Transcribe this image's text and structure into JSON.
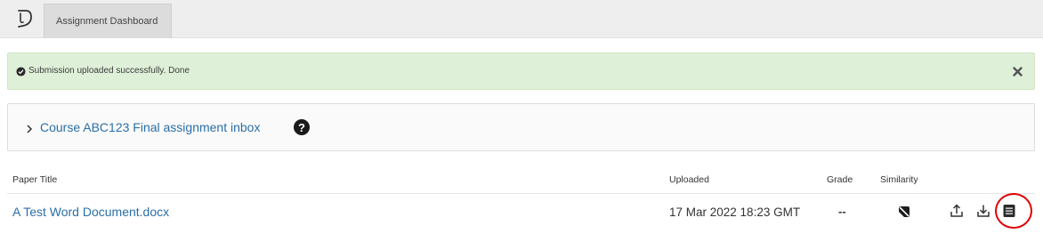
{
  "header": {
    "logo": "turnitin-logo-icon",
    "tab_label": "Assignment Dashboard"
  },
  "alert": {
    "icon": "check-circle-icon",
    "message": "Submission uploaded successfully. Done",
    "close_icon": "close-icon",
    "color": "#dff0d8"
  },
  "inbox": {
    "chevron_icon": "chevron-right-icon",
    "title": "Course ABC123 Final assignment inbox",
    "help_icon": "question-circle-icon",
    "help_glyph": "?"
  },
  "table": {
    "headers": {
      "title": "Paper Title",
      "uploaded": "Uploaded",
      "grade": "Grade",
      "similarity": "Similarity"
    },
    "rows": [
      {
        "title": "A Test Word Document.docx",
        "uploaded": "17 Mar 2022 18:23 GMT",
        "grade": "--",
        "similarity_icon": "similarity-pending-icon",
        "actions": [
          "upload-icon",
          "download-icon",
          "receipt-icon"
        ]
      }
    ]
  },
  "annotation": {
    "highlight_color": "#e00000"
  },
  "colors": {
    "link": "#2a6fa8",
    "topbar": "#eeeeee"
  }
}
